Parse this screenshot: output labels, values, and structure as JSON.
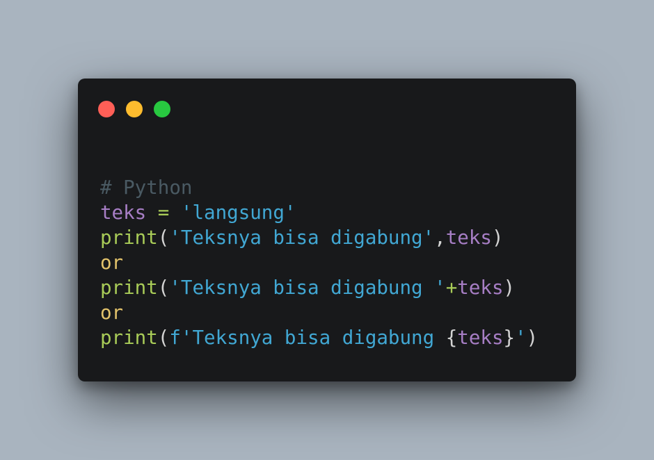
{
  "window": {
    "controls": [
      {
        "name": "close",
        "color": "#ff5f57"
      },
      {
        "name": "minimize",
        "color": "#febc2e"
      },
      {
        "name": "maximize",
        "color": "#28c840"
      }
    ]
  },
  "code": {
    "lines": [
      [
        {
          "t": "# Python",
          "k": "comment"
        }
      ],
      [
        {
          "t": "teks",
          "k": "var"
        },
        {
          "t": " = ",
          "k": "op"
        },
        {
          "t": "'langsung'",
          "k": "str"
        }
      ],
      [
        {
          "t": "print",
          "k": "func"
        },
        {
          "t": "(",
          "k": "punc"
        },
        {
          "t": "'Teksnya bisa digabung'",
          "k": "str"
        },
        {
          "t": ",",
          "k": "punc"
        },
        {
          "t": "teks",
          "k": "var"
        },
        {
          "t": ")",
          "k": "punc"
        }
      ],
      [
        {
          "t": "or",
          "k": "kw"
        }
      ],
      [
        {
          "t": "print",
          "k": "func"
        },
        {
          "t": "(",
          "k": "punc"
        },
        {
          "t": "'Teksnya bisa digabung '",
          "k": "str"
        },
        {
          "t": "+",
          "k": "op"
        },
        {
          "t": "teks",
          "k": "var"
        },
        {
          "t": ")",
          "k": "punc"
        }
      ],
      [
        {
          "t": "or",
          "k": "kw"
        }
      ],
      [
        {
          "t": "print",
          "k": "func"
        },
        {
          "t": "(",
          "k": "punc"
        },
        {
          "t": "f'Teksnya bisa digabung ",
          "k": "str"
        },
        {
          "t": "{",
          "k": "punc"
        },
        {
          "t": "teks",
          "k": "var"
        },
        {
          "t": "}",
          "k": "punc"
        },
        {
          "t": "'",
          "k": "str"
        },
        {
          "t": ")",
          "k": "punc"
        }
      ]
    ]
  }
}
